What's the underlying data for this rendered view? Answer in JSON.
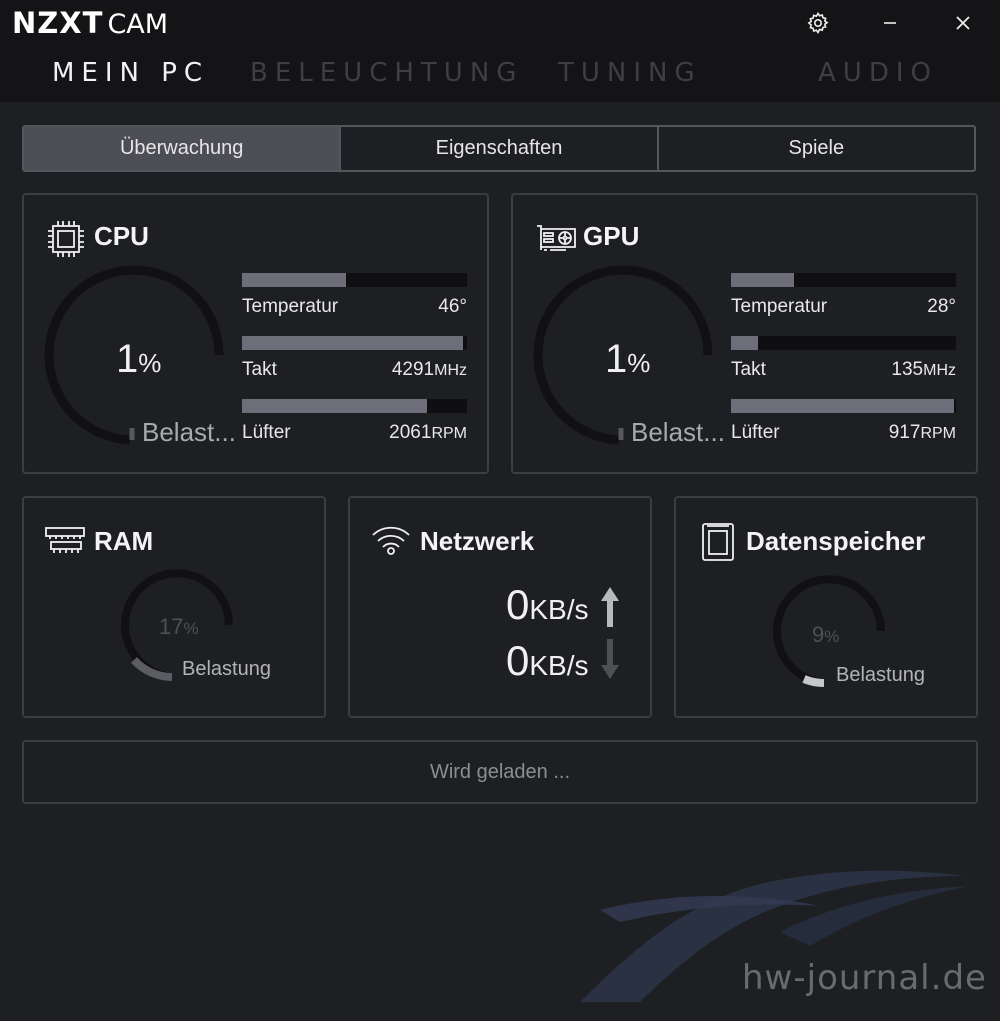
{
  "app": {
    "brand": "NZXT",
    "name": "CAM"
  },
  "nav": [
    "MEIN PC",
    "BELEUCHTUNG",
    "TUNING",
    "AUDIO"
  ],
  "tabs": [
    "Überwachung",
    "Eigenschaften",
    "Spiele"
  ],
  "cpu": {
    "title": "CPU",
    "load_value": "1",
    "load_unit": "%",
    "load_label": "Belast...",
    "metrics": [
      {
        "label": "Temperatur",
        "value": "46°",
        "unit": "",
        "fill": 0.46
      },
      {
        "label": "Takt",
        "value": "4291",
        "unit": "MHz",
        "fill": 0.98
      },
      {
        "label": "Lüfter",
        "value": "2061",
        "unit": "RPM",
        "fill": 0.82
      }
    ]
  },
  "gpu": {
    "title": "GPU",
    "load_value": "1",
    "load_unit": "%",
    "load_label": "Belast...",
    "metrics": [
      {
        "label": "Temperatur",
        "value": "28°",
        "unit": "",
        "fill": 0.28
      },
      {
        "label": "Takt",
        "value": "135",
        "unit": "MHz",
        "fill": 0.12
      },
      {
        "label": "Lüfter",
        "value": "917",
        "unit": "RPM",
        "fill": 0.99
      }
    ]
  },
  "ram": {
    "title": "RAM",
    "value": "17",
    "unit": "%",
    "label": "Belastung",
    "fill": 0.17
  },
  "network": {
    "title": "Netzwerk",
    "up_value": "0",
    "down_value": "0",
    "unit": "KB/s"
  },
  "storage": {
    "title": "Datenspeicher",
    "value": "9",
    "unit": "%",
    "label": "Belastung",
    "fill": 0.09
  },
  "status": {
    "loading": "Wird geladen ..."
  },
  "watermark": "hw-journal.de",
  "colors": {
    "background": "#1e1f22",
    "titlebar": "#141416",
    "bar_fill": "#6d6e7a",
    "tab_selected": "#4d4e55"
  }
}
